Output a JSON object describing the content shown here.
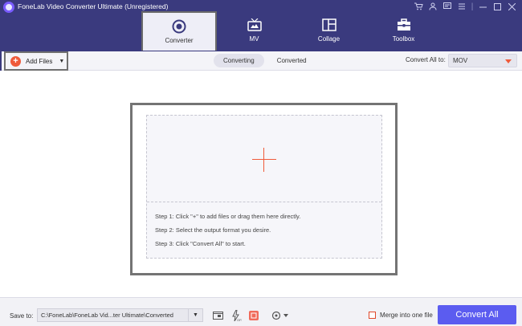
{
  "window": {
    "title": "FoneLab Video Converter Ultimate (Unregistered)",
    "controls": [
      "cart-icon",
      "user-icon",
      "feedback-icon",
      "menu-icon",
      "minimize-icon",
      "maximize-icon",
      "close-icon"
    ]
  },
  "nav": {
    "tabs": [
      {
        "label": "Converter",
        "icon": "converter-icon",
        "active": true
      },
      {
        "label": "MV",
        "icon": "tv-icon",
        "active": false
      },
      {
        "label": "Collage",
        "icon": "collage-icon",
        "active": false
      },
      {
        "label": "Toolbox",
        "icon": "toolbox-icon",
        "active": false
      }
    ]
  },
  "toolbar": {
    "add_files_label": "Add Files",
    "sub_tabs": [
      {
        "label": "Converting",
        "active": true
      },
      {
        "label": "Converted",
        "active": false
      }
    ],
    "convert_all_to_label": "Convert All to:",
    "format_value": "MOV"
  },
  "dropzone": {
    "steps": [
      "Step 1: Click \"+\" to add files or drag them here directly.",
      "Step 2: Select the output format you desire.",
      "Step 3: Click \"Convert All\" to start."
    ]
  },
  "bottom": {
    "save_to_label": "Save to:",
    "save_path": "C:\\FoneLab\\FoneLab Vid...ter Ultimate\\Converted",
    "merge_label": "Merge into one file",
    "merge_checked": false,
    "convert_all_label": "Convert All"
  },
  "colors": {
    "header_bg": "#3a3a7e",
    "accent_orange": "#ef5a3a",
    "convert_button": "#5b5cf0"
  }
}
